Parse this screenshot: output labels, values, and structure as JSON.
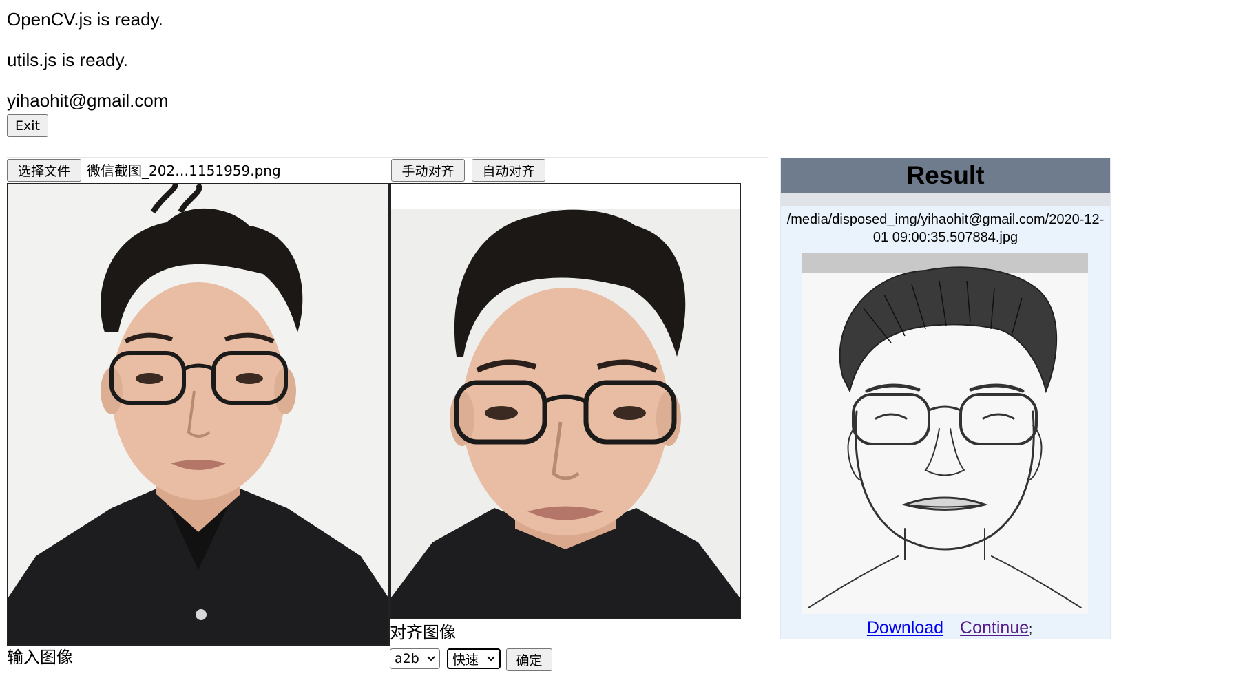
{
  "status": {
    "opencv": "OpenCV.js is ready.",
    "utils": "utils.js is ready.",
    "user_email": "yihaohit@gmail.com",
    "exit_label": "Exit"
  },
  "upload": {
    "choose_file_label": "选择文件",
    "file_name": "微信截图_202…1151959.png"
  },
  "align": {
    "manual_label": "手动对齐",
    "auto_label": "自动对齐"
  },
  "panels": {
    "input_caption": "输入图像",
    "aligned_caption": "对齐图像"
  },
  "controls": {
    "direction_selected": "a2b",
    "speed_selected": "快速",
    "confirm_label": "确定"
  },
  "result": {
    "title": "Result",
    "path": "/media/disposed_img/yihaohit@gmail.com/2020-12-01 09:00:35.507884.jpg",
    "download_label": "Download",
    "continue_label": "Continue",
    "continue_suffix": ";"
  },
  "colors": {
    "result_header": "#6e7c8d",
    "result_bg": "#eaf3fc",
    "link": "#0000ee",
    "visited_link": "#551a8b"
  },
  "icons": {
    "select_arrow": "chevron-down-icon",
    "input_portrait": "person-photo-icon",
    "aligned_portrait": "person-photo-icon",
    "sketch_portrait": "pencil-sketch-portrait"
  }
}
